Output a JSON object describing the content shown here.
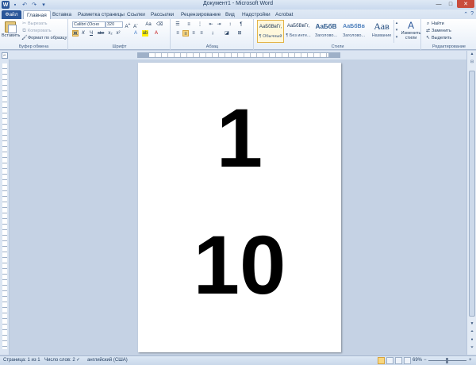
{
  "window": {
    "title": "Документ1 - Microsoft Word",
    "app_icon": "word-icon",
    "qat_icons": [
      "save-icon",
      "undo-icon",
      "redo-icon",
      "customize-icon"
    ]
  },
  "tabs": [
    {
      "label": "Файл"
    },
    {
      "label": "Главная"
    },
    {
      "label": "Вставка"
    },
    {
      "label": "Разметка страницы"
    },
    {
      "label": "Ссылки"
    },
    {
      "label": "Рассылки"
    },
    {
      "label": "Рецензирование"
    },
    {
      "label": "Вид"
    },
    {
      "label": "Надстройки"
    },
    {
      "label": "Acrobat"
    }
  ],
  "ribbon": {
    "clipboard": {
      "label": "Буфер обмена",
      "paste": "Вставить",
      "cut": "Вырезать",
      "copy": "Копировать",
      "format_painter": "Формат по образцу"
    },
    "font": {
      "label": "Шрифт",
      "family": "Calibri (Осно",
      "size": "320",
      "buttons": [
        "Ж",
        "К",
        "Ч",
        "abe",
        "x₂",
        "x²"
      ]
    },
    "paragraph": {
      "label": "Абзац"
    },
    "styles": {
      "label": "Стили",
      "items": [
        {
          "sample": "АаБбВвГг,",
          "name": "¶ Обычный"
        },
        {
          "sample": "АаБбВвГг,",
          "name": "¶ Без инте..."
        },
        {
          "sample": "АаБбВ",
          "name": "Заголово..."
        },
        {
          "sample": "АаБбВв",
          "name": "Заголово..."
        },
        {
          "sample": "Аав",
          "name": "Название"
        }
      ],
      "change_styles": "Изменить стили"
    },
    "editing": {
      "label": "Редактирование",
      "find": "Найти",
      "replace": "Заменить",
      "select": "Выделить"
    }
  },
  "document": {
    "line1": "1",
    "line2": "10"
  },
  "status": {
    "page": "Страница: 1 из 1",
    "words": "Число слов: 2",
    "language": "английский (США)",
    "zoom": "69%",
    "zoom_level": 0.69
  }
}
